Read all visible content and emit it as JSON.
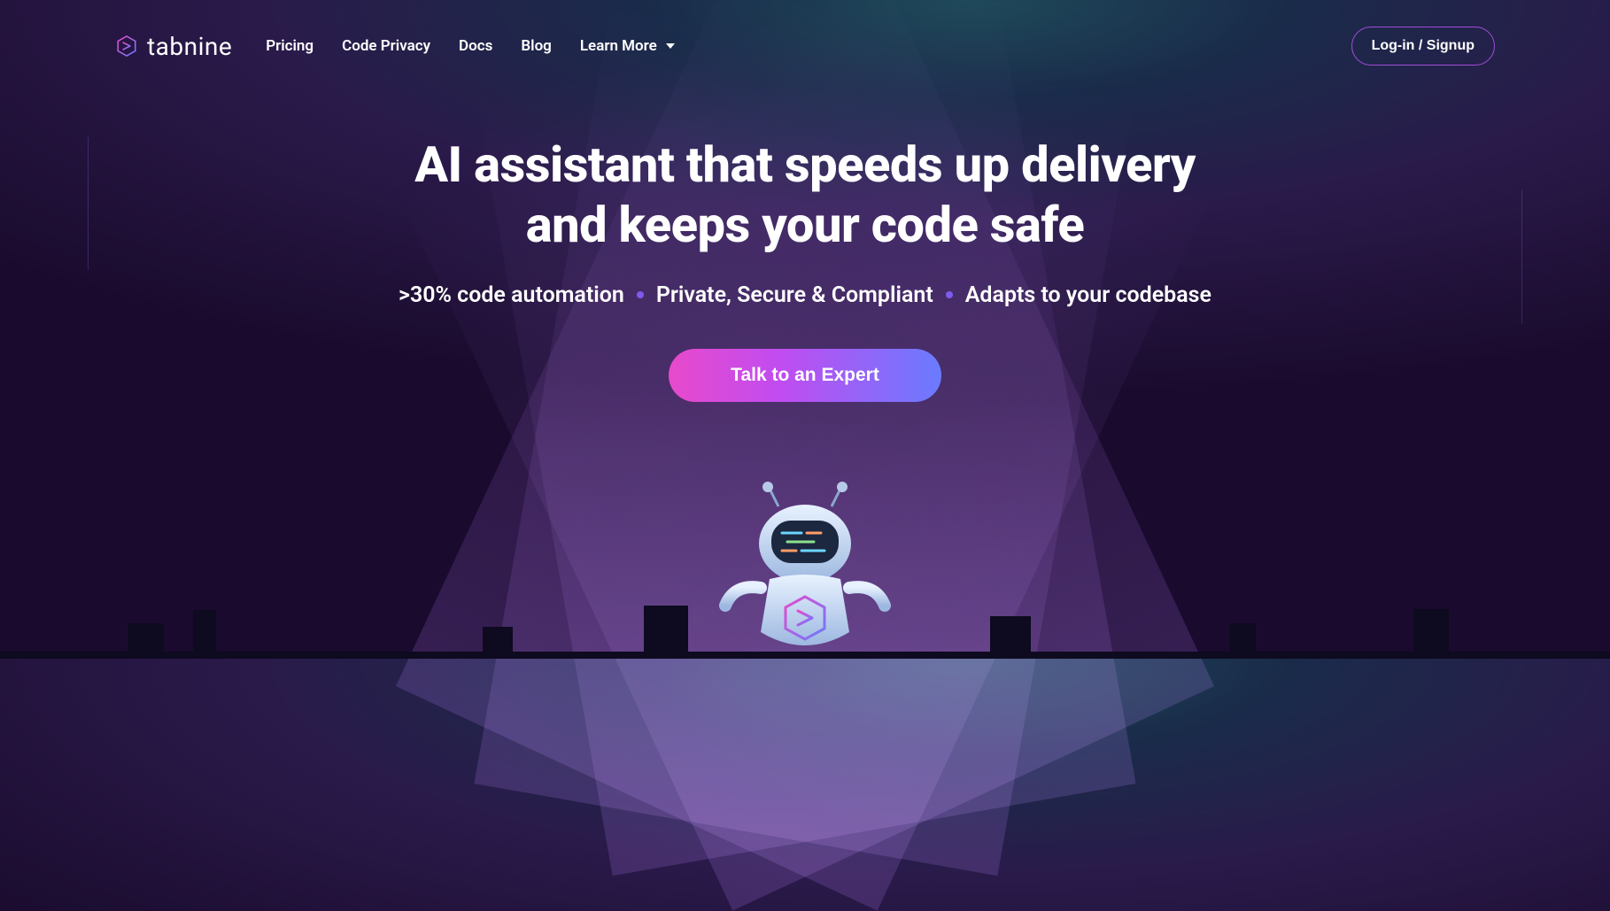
{
  "brand": {
    "name": "tabnine"
  },
  "nav": {
    "items": [
      {
        "label": "Pricing"
      },
      {
        "label": "Code Privacy"
      },
      {
        "label": "Docs"
      },
      {
        "label": "Blog"
      }
    ],
    "learn_more": "Learn More"
  },
  "auth": {
    "login_signup": "Log-in / Signup"
  },
  "hero": {
    "headline_line1": "AI assistant that speeds up delivery",
    "headline_line2": "and keeps your code safe",
    "bullets": [
      ">30% code automation",
      "Private, Secure & Compliant",
      "Adapts to your codebase"
    ],
    "cta": "Talk to an Expert"
  }
}
